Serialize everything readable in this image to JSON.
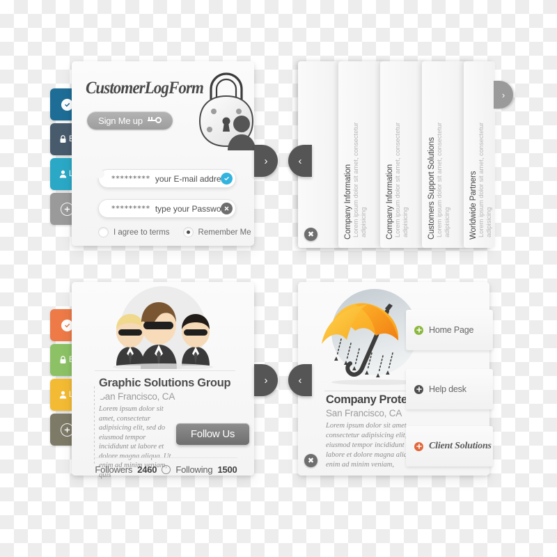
{
  "login_card": {
    "title": "CustomerLogForm",
    "signup_label": "Sign Me up",
    "signup_icon": "key-icon",
    "lock_icon": "padlock-user-icon",
    "email_field": {
      "masked_value": "*********",
      "placeholder": "your E-mail address",
      "badge_icon": "check-circle-icon",
      "badge_glyph": "✔",
      "badge_color": "#33b4de"
    },
    "password_field": {
      "masked_value": "*********",
      "placeholder": "type your Password",
      "badge_icon": "close-circle-icon",
      "badge_glyph": "✖",
      "badge_color": "#6e6e6e"
    },
    "terms_label": "I agree to terms",
    "remember_label": "Remember Me",
    "tabs": [
      {
        "label": "",
        "icon": "check-circle-icon",
        "glyph": "✔",
        "color": "#1d6d96",
        "active": false
      },
      {
        "label": "Become a",
        "icon": "lock-icon",
        "glyph": "🔒",
        "color": "#485b6d",
        "active": false
      },
      {
        "label": "Log In",
        "icon": "person-icon",
        "glyph": "👤",
        "color": "#2aa8c6",
        "active": true
      },
      {
        "label": "",
        "icon": "plus-circle-icon",
        "glyph": "+",
        "color": "#9a9a9a",
        "active": false
      }
    ],
    "handle_right_glyph": "›",
    "handle_right_name": "next-arrow-handle"
  },
  "vertical_panel": {
    "close_glyph": "✖",
    "handle_left_glyph": "‹",
    "cards": [
      {
        "title": "",
        "subtitle": "",
        "handle_color": "",
        "handle_glyph": ""
      },
      {
        "title": "Company Information",
        "subtitle": "Lorem ipsum dolor sit amet, consectetur adipisicing",
        "handle_color": "#555555",
        "handle_glyph": "›"
      },
      {
        "title": "Company Information",
        "subtitle": "Lorem ipsum dolor sit amet, consectetur adipisicing",
        "handle_color": "#2aa8c6",
        "handle_glyph": "›"
      },
      {
        "title": "Customers Support Solutions",
        "subtitle": "Lorem ipsum dolor sit amet, consectetur adipisicing",
        "handle_color": "#f5b73f",
        "handle_glyph": "›"
      },
      {
        "title": "Worldwide Partners",
        "subtitle": "Lorem ipsum dolor sit amet, consectetur adipisicing",
        "handle_color": "#9a9a9a",
        "handle_glyph": "›"
      }
    ]
  },
  "profile_card": {
    "illustration": "three-businessmen-icon",
    "name": "Graphic Solutions Group",
    "location": "San Francisco, CA",
    "body": "Lorem ipsum dolor sit amet, consectetur adipisicing elit, sed do eiusmod tempor incididunt ut labore et dolore magna aliqua. Ut enim ad minim veniam, quis",
    "follow_label": "Follow Us",
    "followers_label": "Followers",
    "followers_count": "2460",
    "following_label": "Following",
    "following_count": "1500",
    "tabs": [
      {
        "label": "",
        "icon": "check-circle-icon",
        "glyph": "✔",
        "color": "#ed7a47",
        "active": false
      },
      {
        "label": "Become a",
        "icon": "lock-icon",
        "glyph": "🔒",
        "color": "#8cc265",
        "active": false
      },
      {
        "label": "Log In",
        "icon": "person-icon",
        "glyph": "👤",
        "color": "#f3bb33",
        "active": true
      },
      {
        "label": "",
        "icon": "plus-circle-icon",
        "glyph": "+",
        "color": "#7d7a68",
        "active": false
      }
    ],
    "handle_right_glyph": "›",
    "handle_right_name": "next-arrow-handle"
  },
  "protection_card": {
    "illustration": "umbrella-rain-icon",
    "name": "Company Protection Plan",
    "location": "San Francisco, CA",
    "body": "Lorem ipsum dolor sit amet, consectetur adipisicing elit, sed do eiusmod tempor incididunt ut labore et dolore magna aliqua. Ut enim ad minim veniam,",
    "close_glyph": "✖",
    "handle_left_glyph": "‹",
    "nav_items": [
      {
        "label": "Home Page",
        "icon": "plus-circle-icon",
        "glyph": "+",
        "color": "#8cb83f",
        "fancy": false
      },
      {
        "label": "Help desk",
        "icon": "plus-circle-icon",
        "glyph": "+",
        "color": "#4f4f4f",
        "fancy": false
      },
      {
        "label": "Client Solutions",
        "icon": "plus-circle-icon",
        "glyph": "+",
        "color": "#e2673a",
        "fancy": true
      }
    ]
  }
}
